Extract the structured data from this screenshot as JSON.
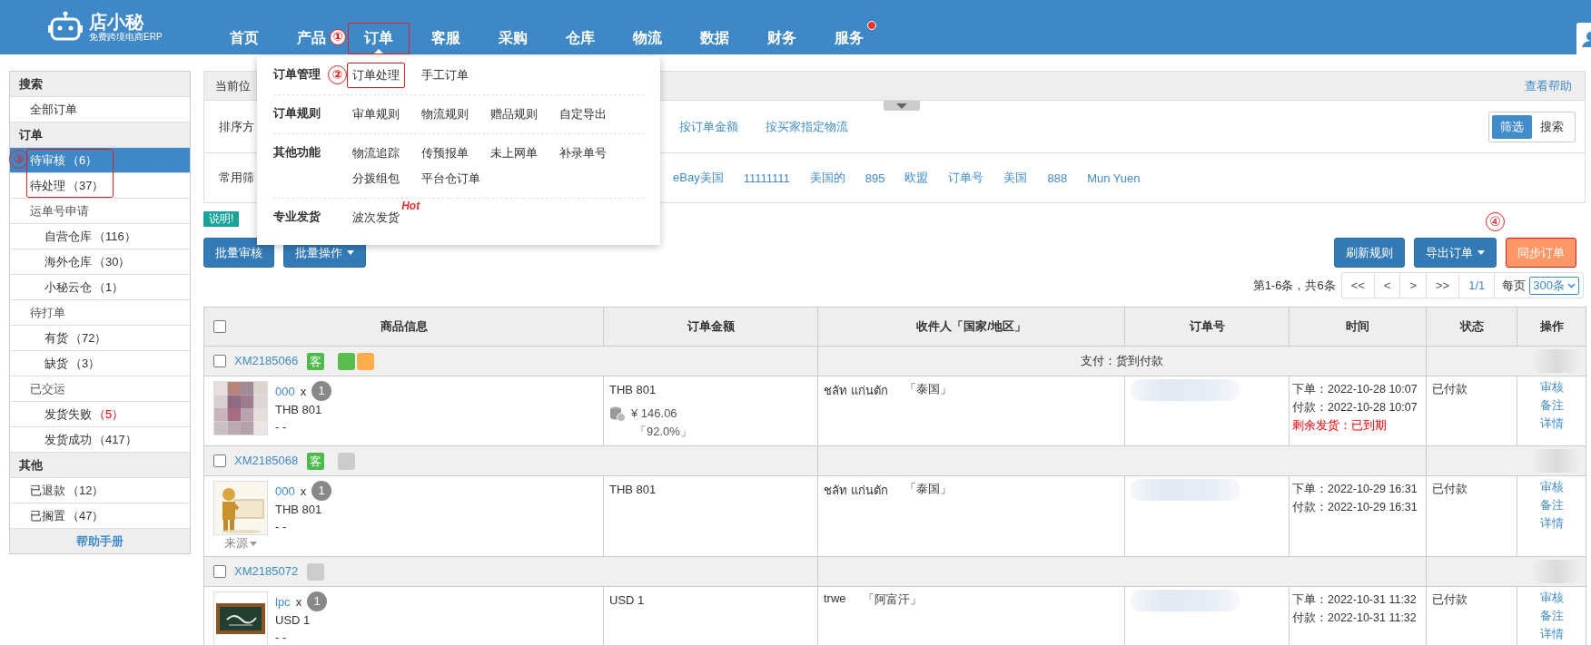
{
  "header": {
    "logo": {
      "name": "店小秘",
      "tagline": "免费跨境电商ERP"
    },
    "nav": [
      {
        "label": "首页",
        "selected": false
      },
      {
        "label": "产品",
        "selected": false
      },
      {
        "label": "订单",
        "selected": true,
        "highlighted": true,
        "annotation": "①"
      },
      {
        "label": "客服",
        "selected": false
      },
      {
        "label": "采购",
        "selected": false
      },
      {
        "label": "仓库",
        "selected": false
      },
      {
        "label": "物流",
        "selected": false
      },
      {
        "label": "数据",
        "selected": false
      },
      {
        "label": "财务",
        "selected": false
      },
      {
        "label": "服务",
        "selected": false,
        "dot": true
      }
    ]
  },
  "menu": {
    "sections": [
      {
        "title": "订单管理",
        "annotation": "②",
        "links": [
          {
            "label": "订单处理",
            "highlighted": true
          },
          {
            "label": "手工订单",
            "highlighted": false
          }
        ]
      },
      {
        "title": "订单规则",
        "links": [
          {
            "label": "审单规则"
          },
          {
            "label": "物流规则"
          },
          {
            "label": "赠品规则"
          },
          {
            "label": "自定导出"
          }
        ]
      },
      {
        "title": "其他功能",
        "links": [
          {
            "label": "物流追踪"
          },
          {
            "label": "传预报单"
          },
          {
            "label": "未上网单"
          },
          {
            "label": "补录单号"
          },
          {
            "label": "分拨组包"
          },
          {
            "label": "平台仓订单"
          }
        ]
      },
      {
        "title": "专业发货",
        "links": [
          {
            "label": "波次发货",
            "hot": "Hot"
          }
        ]
      }
    ]
  },
  "sidebar": {
    "sections": [
      {
        "title": "搜索",
        "items": [
          {
            "label": "全部订单",
            "selected": false
          }
        ]
      },
      {
        "title": "订单",
        "items": [
          {
            "label": "待审核",
            "count": "（6）",
            "alert": false,
            "selected": true,
            "annotated": true,
            "annotation": "③"
          },
          {
            "label": "待处理",
            "count": "（37）",
            "alert": false,
            "selected": false,
            "annotated": true
          },
          {
            "label": "运单号申请",
            "selected": false,
            "children": [
              {
                "label": "自营仓库",
                "count": "（116）",
                "alert": false,
                "selected": false
              },
              {
                "label": "海外仓库",
                "count": "（30）",
                "alert": false,
                "selected": false
              },
              {
                "label": "小秘云仓",
                "count": "（1）",
                "alert": false,
                "selected": false
              }
            ]
          },
          {
            "label": "待打单",
            "selected": false,
            "children": [
              {
                "label": "有货",
                "count": "（72）",
                "alert": false,
                "selected": false
              },
              {
                "label": "缺货",
                "count": "（3）",
                "alert": false,
                "selected": false
              }
            ]
          },
          {
            "label": "已交运",
            "selected": false,
            "children": [
              {
                "label": "发货失败",
                "count": "（5）",
                "alert": true,
                "selected": false
              },
              {
                "label": "发货成功",
                "count": "（417）",
                "alert": false,
                "selected": false
              }
            ]
          }
        ]
      },
      {
        "title": "其他",
        "items": [
          {
            "label": "已退款",
            "count": "（12）",
            "alert": false,
            "selected": false
          },
          {
            "label": "已搁置",
            "count": "（47）",
            "alert": false,
            "selected": false
          }
        ]
      }
    ],
    "help_link": "帮助手册"
  },
  "breadcrumb": {
    "label": "当前位",
    "help_link": "查看帮助"
  },
  "sort_row": {
    "label": "排序方",
    "options": [
      {
        "label": "按订单金额"
      },
      {
        "label": "按买家指定物流"
      }
    ],
    "mode_toggle": [
      {
        "label": "筛选",
        "selected": true
      },
      {
        "label": "搜索",
        "selected": false
      }
    ]
  },
  "filter_row": {
    "label": "常用筛",
    "filters": [
      "eBay美国",
      "11111111",
      "美国的",
      "895",
      "欧盟",
      "订单号",
      "美国",
      "888",
      "Mun Yuen"
    ]
  },
  "notice_tag": "说明!",
  "actions_left": [
    {
      "label": "批量审核",
      "kind": "primary",
      "dropdown": false
    },
    {
      "label": "批量操作",
      "kind": "primary",
      "dropdown": true
    }
  ],
  "actions_right": [
    {
      "label": "刷新规则",
      "kind": "primary",
      "dropdown": false
    },
    {
      "label": "导出订单",
      "kind": "primary",
      "dropdown": true
    },
    {
      "label": "同步订单",
      "kind": "warning",
      "dropdown": false,
      "highlighted": true,
      "annotation": "④"
    }
  ],
  "pagination": {
    "summary": "第1-6条，共6条",
    "buttons": [
      "<<",
      "<",
      ">",
      ">>"
    ],
    "page": "1/1",
    "per_page_label": "每页",
    "per_page": "300条"
  },
  "table": {
    "select_all": {
      "checked": false
    },
    "columns": [
      "商品信息",
      "订单金额",
      "收件人「国家/地区」",
      "订单号",
      "时间",
      "状态",
      "操作"
    ],
    "orders": [
      {
        "checked": false,
        "order_id": "XM2185066",
        "customer_tag": "客",
        "color_tags": [
          {
            "color": "#5cbd4f"
          },
          {
            "color": "#ffad4d"
          }
        ],
        "payment_note": "支付：货到付款",
        "header_blurred": true,
        "item": {
          "name": "000",
          "times": "x",
          "qty": "1",
          "price": "THB 801",
          "sku": "- -"
        },
        "amount": "THB 801",
        "profit": {
          "value": "¥  146.06",
          "rate": "「92.0%」"
        },
        "recipient": "ชลัท แก่นตัก",
        "country": "「泰国」",
        "order_number_blurred": true,
        "ordered": "下单：2022-10-28 10:07",
        "paid": "付款：2022-10-28 10:07",
        "deadline": "剩余发货：已到期",
        "status": "已付款",
        "actions": [
          "审核",
          "备注",
          "详情"
        ]
      },
      {
        "checked": false,
        "order_id": "XM2185068",
        "customer_tag": "客",
        "color_tags": [
          {
            "color": "#cccccc"
          }
        ],
        "header_blurred": true,
        "item": {
          "name": "000",
          "times": "x",
          "qty": "1",
          "price": "THB 801",
          "sku": "- -",
          "source_menu": "来源"
        },
        "amount": "THB 801",
        "recipient": "ชลัท แก่นตัก",
        "country": "「泰国」",
        "order_number_blurred": true,
        "ordered": "下单：2022-10-29 16:31",
        "paid": "付款：2022-10-29 16:31",
        "status": "已付款",
        "actions": [
          "审核",
          "备注",
          "详情"
        ]
      },
      {
        "checked": false,
        "order_id": "XM2185072",
        "color_tags": [
          {
            "color": "#cccccc"
          }
        ],
        "header_blurred": true,
        "item": {
          "name": "lpc",
          "times": "x",
          "qty": "1",
          "price": "USD 1",
          "sku": "- -"
        },
        "amount": "USD 1",
        "recipient": "trwe",
        "country": "「阿富汗」",
        "order_number_blurred": true,
        "ordered": "下单：2022-10-31 11:32",
        "paid": "付款：2022-10-31 11:32",
        "status": "已付款",
        "actions": [
          "审核",
          "备注",
          "详情"
        ]
      }
    ]
  }
}
